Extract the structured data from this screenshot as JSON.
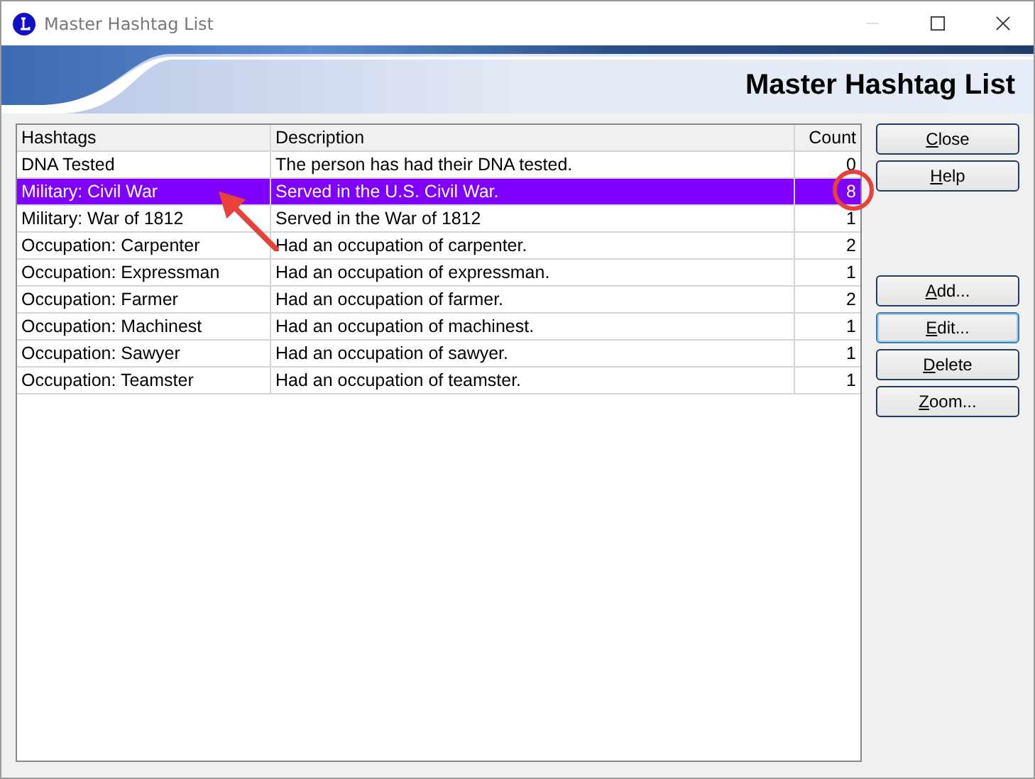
{
  "window": {
    "title": "Master Hashtag List"
  },
  "banner": {
    "title": "Master Hashtag List"
  },
  "table": {
    "columns": [
      "Hashtags",
      "Description",
      "Count"
    ],
    "rows": [
      {
        "cells": [
          "DNA Tested",
          "The person has had their DNA tested.",
          "0"
        ],
        "selected": false
      },
      {
        "cells": [
          "Military: Civil War",
          "Served in the U.S. Civil War.",
          "8"
        ],
        "selected": true
      },
      {
        "cells": [
          "Military: War of 1812",
          "Served in the War of 1812",
          "1"
        ],
        "selected": false
      },
      {
        "cells": [
          "Occupation: Carpenter",
          "Had an occupation of carpenter.",
          "2"
        ],
        "selected": false
      },
      {
        "cells": [
          "Occupation: Expressman",
          "Had an occupation of expressman.",
          "1"
        ],
        "selected": false
      },
      {
        "cells": [
          "Occupation: Farmer",
          "Had an occupation of farmer.",
          "2"
        ],
        "selected": false
      },
      {
        "cells": [
          "Occupation: Machinest",
          "Had an occupation of machinest.",
          "1"
        ],
        "selected": false
      },
      {
        "cells": [
          "Occupation: Sawyer",
          "Had an occupation of sawyer.",
          "1"
        ],
        "selected": false
      },
      {
        "cells": [
          "Occupation: Teamster",
          "Had an occupation of teamster.",
          "1"
        ],
        "selected": false
      }
    ]
  },
  "button_groups": [
    [
      {
        "label": "Close",
        "focused": false
      },
      {
        "label": "Help",
        "focused": false
      }
    ],
    [
      {
        "label": "Add...",
        "focused": false
      },
      {
        "label": "Edit...",
        "focused": true
      },
      {
        "label": "Delete",
        "focused": false
      },
      {
        "label": "Zoom...",
        "focused": false
      }
    ]
  ]
}
